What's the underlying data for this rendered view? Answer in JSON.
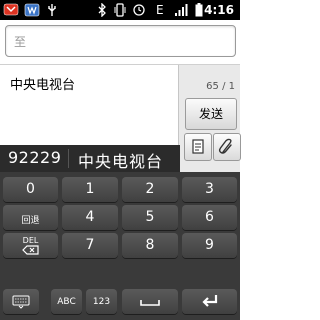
{
  "status": {
    "time": "4:16",
    "network_letter": "E"
  },
  "compose": {
    "to_placeholder": "至",
    "message_text": "中央电视台",
    "counter": "65 / 1",
    "send_label": "发送"
  },
  "ime": {
    "code": "92229",
    "candidate": "中央电视台"
  },
  "keyboard": {
    "rows": [
      [
        "0",
        "1",
        "2",
        "3"
      ],
      [
        "回退",
        "4",
        "5",
        "6"
      ],
      [
        "DEL",
        "7",
        "8",
        "9"
      ]
    ],
    "bottom": {
      "abc": "ABC",
      "num": "123"
    }
  },
  "colors": {
    "keyboard_bg": "#3a3a3a",
    "key": "#4a4a4a",
    "candidate_bar": "#2b2b2b"
  },
  "icons": [
    "notification-icon",
    "whatsapp-like-icon",
    "usb-icon",
    "bluetooth-icon",
    "vibrate-icon",
    "alarm-icon",
    "signal-icon",
    "battery-icon",
    "attach-icon",
    "paperclip-icon",
    "keyboard-icon",
    "backspace-icon",
    "space-icon",
    "enter-icon"
  ]
}
